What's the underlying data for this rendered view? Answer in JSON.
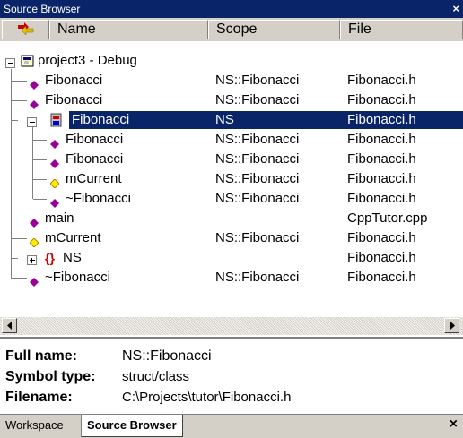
{
  "window": {
    "title": "Source Browser",
    "close_glyph": "×"
  },
  "header": {
    "icon": "sort-icon",
    "name": "Name",
    "scope": "Scope",
    "file": "File"
  },
  "tree": [
    {
      "name": "project3 - Debug",
      "scope": "",
      "file": "",
      "icon": "project-icon",
      "expander": "minus"
    },
    {
      "name": "Fibonacci",
      "scope": "NS::Fibonacci",
      "file": "Fibonacci.h",
      "icon": "method-icon"
    },
    {
      "name": "Fibonacci",
      "scope": "NS::Fibonacci",
      "file": "Fibonacci.h",
      "icon": "method-icon"
    },
    {
      "name": "Fibonacci",
      "scope": "NS",
      "file": "Fibonacci.h",
      "icon": "class-icon",
      "expander": "minus",
      "selected": true
    },
    {
      "name": "Fibonacci",
      "scope": "NS::Fibonacci",
      "file": "Fibonacci.h",
      "icon": "method-icon"
    },
    {
      "name": "Fibonacci",
      "scope": "NS::Fibonacci",
      "file": "Fibonacci.h",
      "icon": "method-icon"
    },
    {
      "name": "mCurrent",
      "scope": "NS::Fibonacci",
      "file": "Fibonacci.h",
      "icon": "field-icon"
    },
    {
      "name": "~Fibonacci",
      "scope": "NS::Fibonacci",
      "file": "Fibonacci.h",
      "icon": "method-icon"
    },
    {
      "name": "main",
      "scope": "",
      "file": "CppTutor.cpp",
      "icon": "method-icon"
    },
    {
      "name": "mCurrent",
      "scope": "NS::Fibonacci",
      "file": "Fibonacci.h",
      "icon": "field-icon"
    },
    {
      "name": "NS",
      "scope": "",
      "file": "Fibonacci.h",
      "icon": "namespace-icon",
      "expander": "plus"
    },
    {
      "name": "~Fibonacci",
      "scope": "NS::Fibonacci",
      "file": "Fibonacci.h",
      "icon": "method-icon"
    }
  ],
  "info": {
    "full_name_label": "Full name:",
    "full_name_value": "NS::Fibonacci",
    "symbol_type_label": "Symbol type:",
    "symbol_type_value": "struct/class",
    "filename_label": "Filename:",
    "filename_value": "C:\\Projects\\tutor\\Fibonacci.h"
  },
  "tabs": {
    "workspace": "Workspace",
    "source_browser": "Source Browser",
    "close_glyph": "×"
  },
  "colors": {
    "selection": "#0a246a",
    "method": "#990099",
    "field": "#ffcc00",
    "namespace": "#cc0000"
  }
}
